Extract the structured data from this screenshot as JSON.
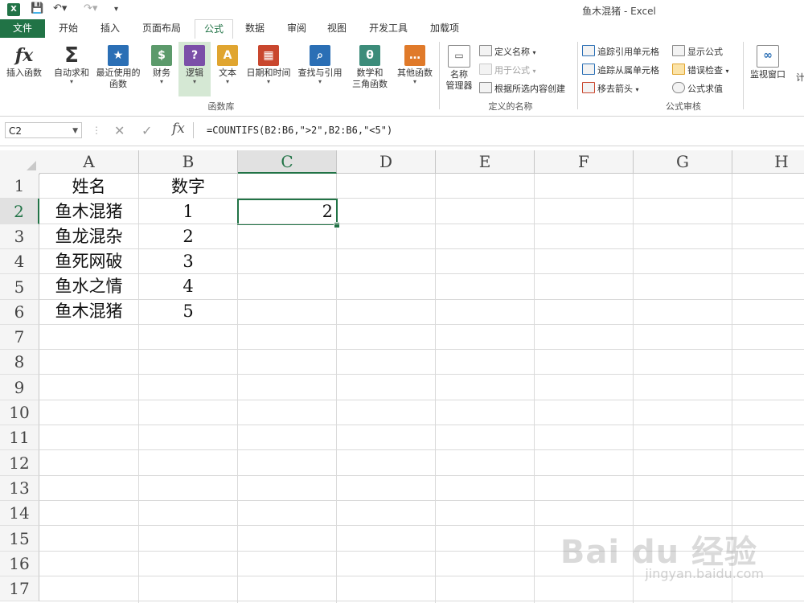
{
  "window": {
    "title": "鱼木混猪 - Excel"
  },
  "quick_access": {
    "app_icon": "X",
    "save_icon": "save-icon",
    "undo_icon": "undo-icon",
    "redo_icon": "redo-icon"
  },
  "tabs": [
    "文件",
    "开始",
    "插入",
    "页面布局",
    "公式",
    "数据",
    "审阅",
    "视图",
    "开发工具",
    "加载项"
  ],
  "ribbon": {
    "function_library": {
      "group_label": "函数库",
      "insert_function": "插入函数",
      "autosum": "自动求和",
      "recently_used": [
        "最近使用的",
        "函数"
      ],
      "financial": "财务",
      "logical": "逻辑",
      "text": "文本",
      "date_time": "日期和时间",
      "lookup": "查找与引用",
      "math_trig": [
        "数学和",
        "三角函数"
      ],
      "more_functions": "其他函数"
    },
    "defined_names": {
      "group_label": "定义的名称",
      "name_manager": [
        "名称",
        "管理器"
      ],
      "define_name": "定义名称",
      "use_in_formula": "用于公式",
      "create_from_selection": "根据所选内容创建"
    },
    "formula_auditing": {
      "group_label": "公式审核",
      "trace_precedents": "追踪引用单元格",
      "trace_dependents": "追踪从属单元格",
      "remove_arrows": "移去箭头",
      "show_formulas": "显示公式",
      "error_checking": "错误检查",
      "evaluate_formula": "公式求值",
      "watch_window": "监视窗口",
      "cut_off": "计"
    }
  },
  "formula_bar": {
    "name_box": "C2",
    "cancel_icon": "✕",
    "enter_icon": "✓",
    "fx": "fx",
    "formula": "=COUNTIFS(B2:B6,\">2\",B2:B6,\"<5\")"
  },
  "sheet": {
    "columns": [
      "A",
      "B",
      "C",
      "D",
      "E",
      "F",
      "G",
      "H"
    ],
    "rows": [
      "1",
      "2",
      "3",
      "4",
      "5",
      "6",
      "7",
      "8",
      "9",
      "10",
      "11",
      "12",
      "13",
      "14",
      "15",
      "16",
      "17"
    ],
    "active_cell": "C2",
    "cells": {
      "A1": "姓名",
      "B1": "数字",
      "A2": "鱼木混猪",
      "B2": "1",
      "C2": "2",
      "A3": "鱼龙混杂",
      "B3": "2",
      "A4": "鱼死网破",
      "B4": "3",
      "A5": "鱼水之情",
      "B5": "4",
      "A6": "鱼木混猪",
      "B6": "5"
    }
  },
  "watermark": {
    "brand": "Bai du 经验",
    "url": "jingyan.baidu.com"
  }
}
